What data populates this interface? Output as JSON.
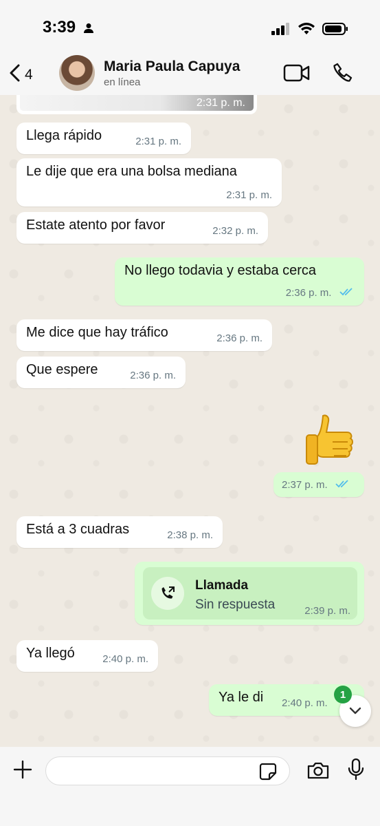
{
  "status_bar": {
    "time": "3:39"
  },
  "header": {
    "back_count": "4",
    "contact_name": "Maria Paula Capuya",
    "contact_status": "en línea"
  },
  "chat": {
    "previous_image_time": "2:31 p. m.",
    "messages": [
      {
        "direction": "in",
        "text": "Llega rápido",
        "time": "2:31 p. m."
      },
      {
        "direction": "in",
        "text": "Le dije que era una bolsa mediana",
        "time": "2:31 p. m."
      },
      {
        "direction": "in",
        "text": "Estate atento por favor",
        "time": "2:32 p. m."
      },
      {
        "direction": "out",
        "text": "No llego todavia y estaba cerca",
        "time": "2:36 p. m.",
        "read": true
      },
      {
        "direction": "in",
        "text": "Me dice que hay tráfico",
        "time": "2:36 p. m."
      },
      {
        "direction": "in",
        "text": "Que espere",
        "time": "2:36 p. m."
      },
      {
        "direction": "out",
        "text": "",
        "emoji": "thumbs-up",
        "time": "2:37 p. m.",
        "read": true
      },
      {
        "direction": "in",
        "text": "Está a 3 cuadras",
        "time": "2:38 p. m."
      },
      {
        "direction": "in",
        "text": "Ya llegó",
        "time": "2:40 p. m."
      },
      {
        "direction": "out",
        "text": "Ya le di",
        "time": "2:40 p. m."
      }
    ],
    "call": {
      "title": "Llamada",
      "subtitle": "Sin respuesta",
      "time": "2:39 p. m."
    },
    "unread_badge": "1"
  },
  "input": {
    "placeholder": ""
  },
  "colors": {
    "chat_bg": "#efeae2",
    "bubble_in": "#ffffff",
    "bubble_out": "#d9fdd3",
    "read_ticks": "#53bdeb",
    "badge": "#25a244"
  }
}
